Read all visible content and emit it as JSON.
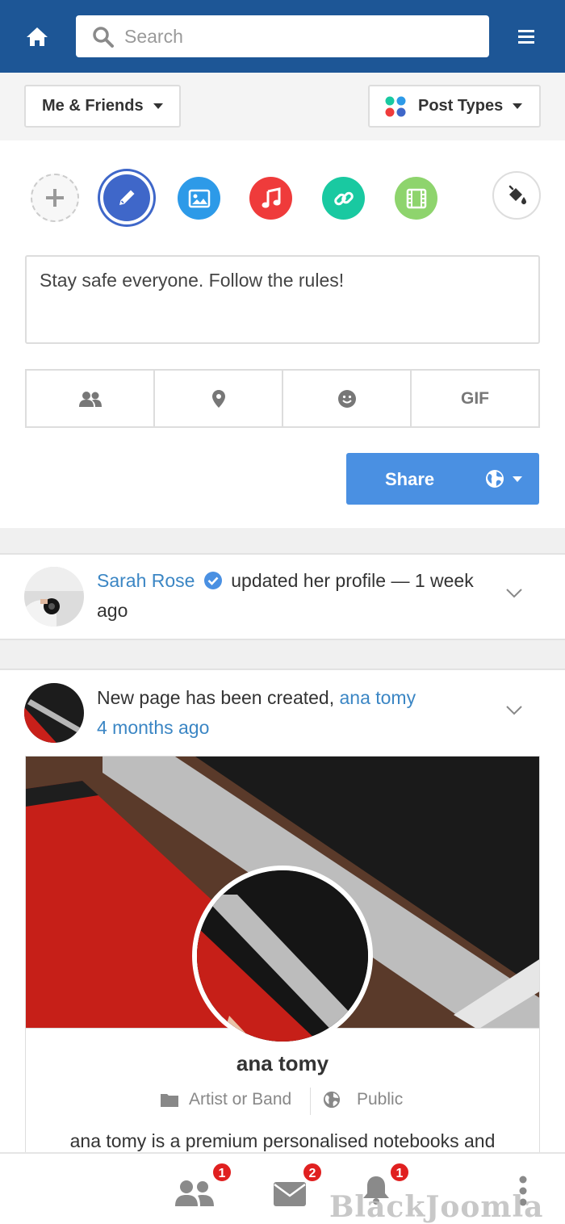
{
  "header": {
    "search_placeholder": "Search"
  },
  "filters": {
    "scope_label": "Me & Friends",
    "post_types_label": "Post Types"
  },
  "composer": {
    "status_text": "Stay safe everyone. Follow the rules!",
    "gif_label": "GIF",
    "share_label": "Share",
    "post_type_colors": {
      "status": "#3f67c9",
      "photo": "#2d9ae8",
      "audio": "#ef3b3b",
      "link": "#19c9a1",
      "video": "#8ed46d"
    }
  },
  "feed": [
    {
      "actor": "Sarah Rose",
      "action": "updated her profile — 1 week ago",
      "verified": true
    },
    {
      "message": "New page has been created,",
      "actor": "ana tomy",
      "time": "4 months ago",
      "page": {
        "name": "ana tomy",
        "category": "Artist or Band",
        "privacy": "Public",
        "description": "ana tomy is a premium personalised notebooks and"
      }
    }
  ],
  "bottom_nav": {
    "friends_badge": "1",
    "messages_badge": "2",
    "notifications_badge": "1"
  },
  "watermark": "BlackJoomla",
  "colors": {
    "header_bg": "#1d5696",
    "link": "#3b86c4",
    "share_bg": "#4a90e2",
    "badge": "#e02020"
  }
}
